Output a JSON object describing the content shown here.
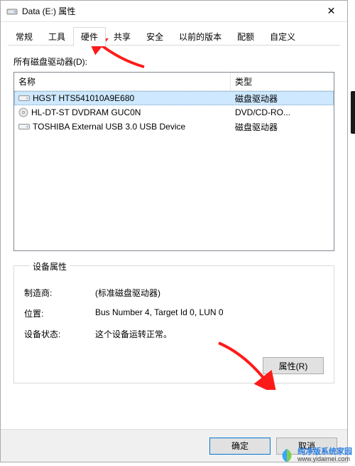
{
  "window": {
    "title": "Data (E:) 属性",
    "close_glyph": "✕"
  },
  "tabs": {
    "items": [
      {
        "label": "常规"
      },
      {
        "label": "工具"
      },
      {
        "label": "硬件"
      },
      {
        "label": "共享"
      },
      {
        "label": "安全"
      },
      {
        "label": "以前的版本"
      },
      {
        "label": "配额"
      },
      {
        "label": "自定义"
      }
    ],
    "active_index": 2
  },
  "hardware": {
    "list_label": "所有磁盘驱动器(D):",
    "columns": {
      "name": "名称",
      "type": "类型"
    },
    "rows": [
      {
        "icon": "hdd",
        "name": "HGST HTS541010A9E680",
        "type": "磁盘驱动器",
        "selected": true
      },
      {
        "icon": "disc",
        "name": "HL-DT-ST DVDRAM GUC0N",
        "type": "DVD/CD-RO...",
        "selected": false
      },
      {
        "icon": "hdd",
        "name": "TOSHIBA External USB 3.0 USB Device",
        "type": "磁盘驱动器",
        "selected": false
      }
    ],
    "group_title": "设备属性",
    "manufacturer_label": "制造商:",
    "manufacturer_value": "(标准磁盘驱动器)",
    "location_label": "位置:",
    "location_value": "Bus Number 4, Target Id 0, LUN 0",
    "status_label": "设备状态:",
    "status_value": "这个设备运转正常。",
    "properties_button": "属性(R)"
  },
  "dialog": {
    "ok": "确定",
    "cancel": "取消"
  },
  "watermark": {
    "title": "纯净版系统家园",
    "url": "www.yidaimei.com"
  }
}
